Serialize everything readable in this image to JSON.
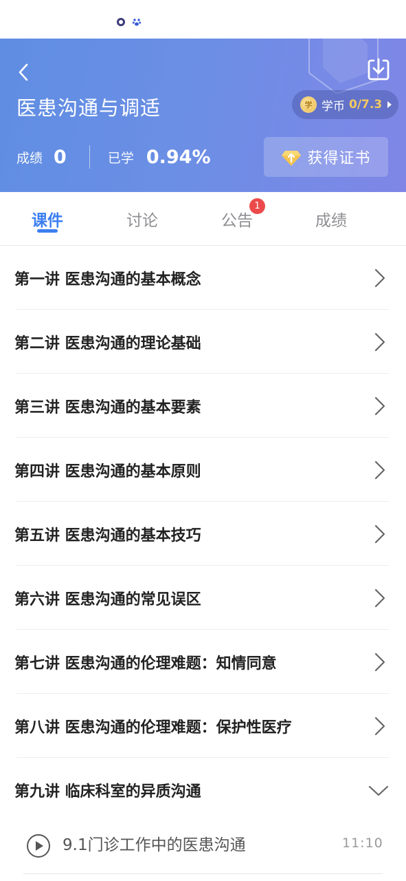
{
  "header": {
    "title": "医患沟通与调适",
    "coin": {
      "label": "学币",
      "value": "0/7.3"
    },
    "stats": {
      "score_label": "成绩",
      "score_value": "0",
      "progress_label": "已学",
      "progress_value": "0.94%"
    },
    "certificate_label": "获得证书"
  },
  "tabs": [
    {
      "label": "课件"
    },
    {
      "label": "讨论"
    },
    {
      "label": "公告",
      "badge": "1"
    },
    {
      "label": "成绩"
    }
  ],
  "lectures": [
    {
      "title": "第一讲  医患沟通的基本概念"
    },
    {
      "title": "第二讲  医患沟通的理论基础"
    },
    {
      "title": "第三讲  医患沟通的基本要素"
    },
    {
      "title": "第四讲  医患沟通的基本原则"
    },
    {
      "title": "第五讲  医患沟通的基本技巧"
    },
    {
      "title": "第六讲  医患沟通的常见误区"
    },
    {
      "title": "第七讲  医患沟通的伦理难题：知情同意"
    },
    {
      "title": "第八讲  医患沟通的伦理难题：保护性医疗"
    },
    {
      "title": "第九讲  临床科室的异质沟通"
    }
  ],
  "sub_items": [
    {
      "title": "9.1门诊工作中的医患沟通",
      "duration": "11:10"
    }
  ],
  "colors": {
    "accent": "#3c7ff0",
    "header_start": "#5f8de2",
    "header_end": "#7f86e6",
    "badge": "#ec4a4a",
    "coin": "#f2c962"
  }
}
